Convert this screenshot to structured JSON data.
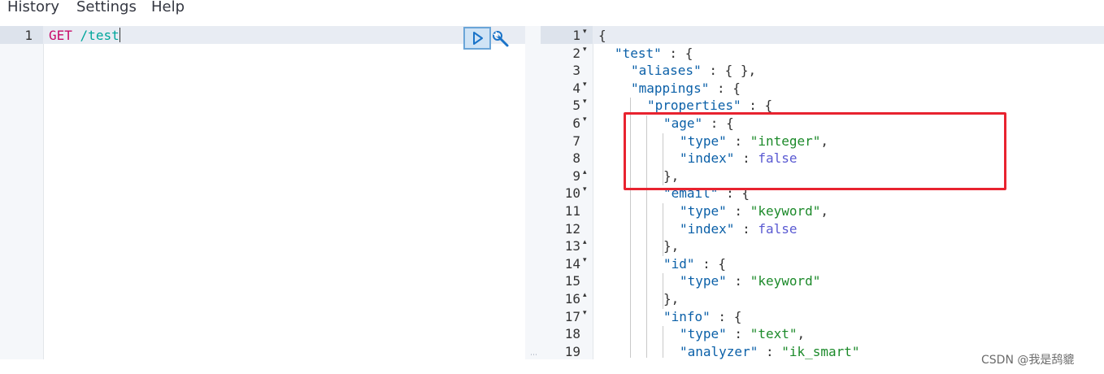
{
  "menu": {
    "items": [
      "History",
      "Settings",
      "Help"
    ]
  },
  "request_editor": {
    "line_number": "1",
    "method": "GET",
    "path": "/test"
  },
  "response_editor": {
    "lines": [
      {
        "n": "1",
        "fold": "open",
        "indent": 0,
        "tokens": [
          {
            "t": "p",
            "v": "{"
          }
        ]
      },
      {
        "n": "2",
        "fold": "open",
        "indent": 1,
        "tokens": [
          {
            "t": "k",
            "v": "\"test\""
          },
          {
            "t": "p",
            "v": " : {"
          }
        ]
      },
      {
        "n": "3",
        "fold": "",
        "indent": 2,
        "tokens": [
          {
            "t": "k",
            "v": "\"aliases\""
          },
          {
            "t": "p",
            "v": " : { },"
          }
        ]
      },
      {
        "n": "4",
        "fold": "open",
        "indent": 2,
        "tokens": [
          {
            "t": "k",
            "v": "\"mappings\""
          },
          {
            "t": "p",
            "v": " : {"
          }
        ]
      },
      {
        "n": "5",
        "fold": "open",
        "indent": 3,
        "tokens": [
          {
            "t": "k",
            "v": "\"properties\""
          },
          {
            "t": "p",
            "v": " : {"
          }
        ]
      },
      {
        "n": "6",
        "fold": "open",
        "indent": 4,
        "tokens": [
          {
            "t": "k",
            "v": "\"age\""
          },
          {
            "t": "p",
            "v": " : {"
          }
        ]
      },
      {
        "n": "7",
        "fold": "",
        "indent": 5,
        "tokens": [
          {
            "t": "k",
            "v": "\"type\""
          },
          {
            "t": "p",
            "v": " : "
          },
          {
            "t": "s",
            "v": "\"integer\""
          },
          {
            "t": "p",
            "v": ","
          }
        ]
      },
      {
        "n": "8",
        "fold": "",
        "indent": 5,
        "tokens": [
          {
            "t": "k",
            "v": "\"index\""
          },
          {
            "t": "p",
            "v": " : "
          },
          {
            "t": "b",
            "v": "false"
          }
        ]
      },
      {
        "n": "9",
        "fold": "close",
        "indent": 4,
        "tokens": [
          {
            "t": "p",
            "v": "},"
          }
        ]
      },
      {
        "n": "10",
        "fold": "open",
        "indent": 4,
        "tokens": [
          {
            "t": "k",
            "v": "\"email\""
          },
          {
            "t": "p",
            "v": " : {"
          }
        ]
      },
      {
        "n": "11",
        "fold": "",
        "indent": 5,
        "tokens": [
          {
            "t": "k",
            "v": "\"type\""
          },
          {
            "t": "p",
            "v": " : "
          },
          {
            "t": "s",
            "v": "\"keyword\""
          },
          {
            "t": "p",
            "v": ","
          }
        ]
      },
      {
        "n": "12",
        "fold": "",
        "indent": 5,
        "tokens": [
          {
            "t": "k",
            "v": "\"index\""
          },
          {
            "t": "p",
            "v": " : "
          },
          {
            "t": "b",
            "v": "false"
          }
        ]
      },
      {
        "n": "13",
        "fold": "close",
        "indent": 4,
        "tokens": [
          {
            "t": "p",
            "v": "},"
          }
        ]
      },
      {
        "n": "14",
        "fold": "open",
        "indent": 4,
        "tokens": [
          {
            "t": "k",
            "v": "\"id\""
          },
          {
            "t": "p",
            "v": " : {"
          }
        ]
      },
      {
        "n": "15",
        "fold": "",
        "indent": 5,
        "tokens": [
          {
            "t": "k",
            "v": "\"type\""
          },
          {
            "t": "p",
            "v": " : "
          },
          {
            "t": "s",
            "v": "\"keyword\""
          }
        ]
      },
      {
        "n": "16",
        "fold": "close",
        "indent": 4,
        "tokens": [
          {
            "t": "p",
            "v": "},"
          }
        ]
      },
      {
        "n": "17",
        "fold": "open",
        "indent": 4,
        "tokens": [
          {
            "t": "k",
            "v": "\"info\""
          },
          {
            "t": "p",
            "v": " : {"
          }
        ]
      },
      {
        "n": "18",
        "fold": "",
        "indent": 5,
        "tokens": [
          {
            "t": "k",
            "v": "\"type\""
          },
          {
            "t": "p",
            "v": " : "
          },
          {
            "t": "s",
            "v": "\"text\""
          },
          {
            "t": "p",
            "v": ","
          }
        ]
      },
      {
        "n": "19",
        "fold": "",
        "indent": 5,
        "tokens": [
          {
            "t": "k",
            "v": "\"analyzer\""
          },
          {
            "t": "p",
            "v": " : "
          },
          {
            "t": "s",
            "v": "\"ik_smart\""
          }
        ]
      }
    ]
  },
  "colors": {
    "method": "#c80a68",
    "path": "#00a69b",
    "json_key": "#0b60a8",
    "json_string": "#1c8a2a",
    "json_bool": "#5a5ad2",
    "highlight_box": "#e8232f"
  },
  "icons": {
    "run": "play-icon",
    "settings": "wrench-icon"
  },
  "watermark": "CSDN @我是鸹貔"
}
